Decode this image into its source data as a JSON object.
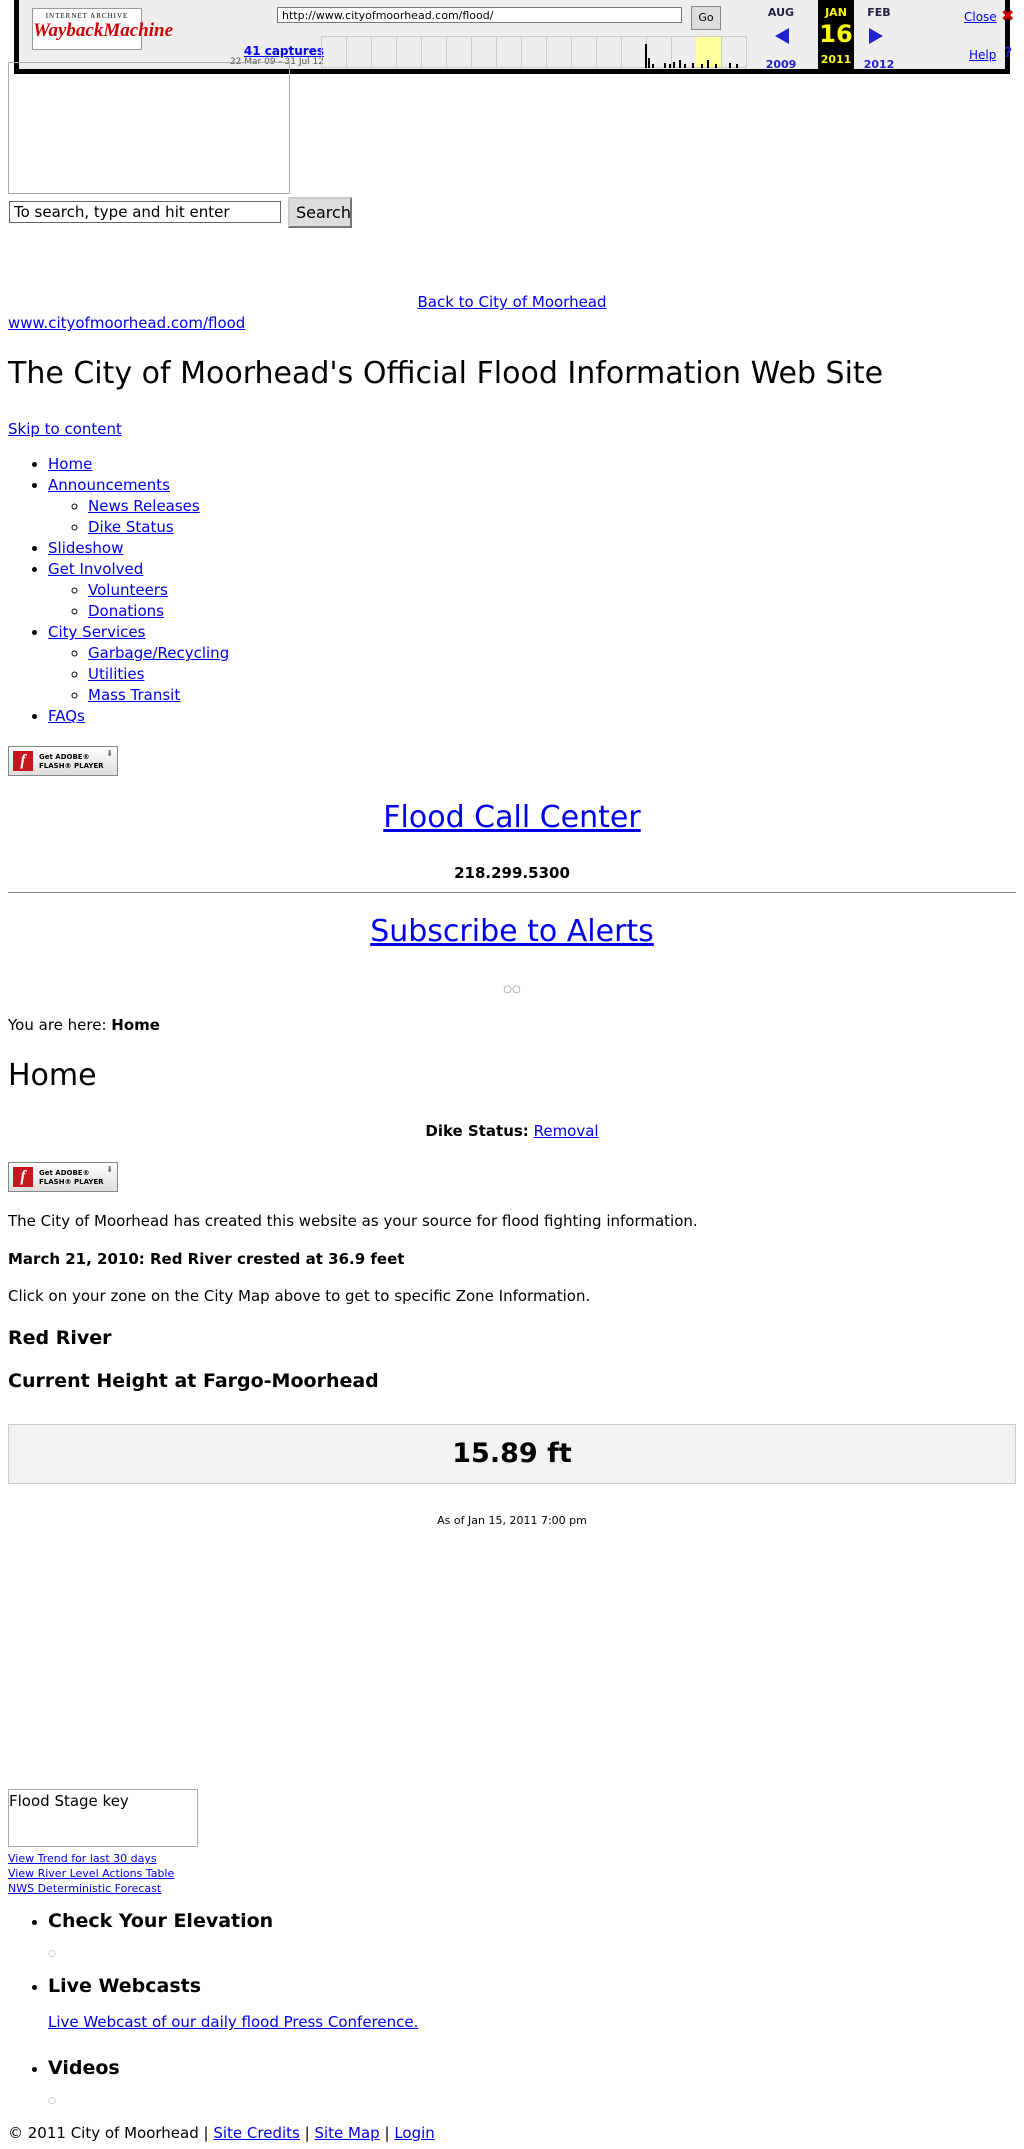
{
  "wayback": {
    "logo_top": "INTERNET ARCHIVE",
    "logo_main": "WaybackMachine",
    "url": "http://www.cityofmoorhead.com/flood/",
    "go_label": "Go",
    "captures_label": "41 captures",
    "range_label": "22 Mar 09 - 31 Jul 12",
    "prev_month": "AUG",
    "cur_month": "JAN",
    "next_month": "FEB",
    "prev_year": "2009",
    "cur_day": "16",
    "cur_year": "2011",
    "next_year": "2012",
    "close_label": "Close",
    "help_label": "Help",
    "close_glyph": "✖",
    "help_glyph": "?"
  },
  "search": {
    "value": "To search, type and hit enter",
    "button_label": "Search"
  },
  "header": {
    "back_link": "Back to City of Moorhead",
    "site_url": "www.cityofmoorhead.com/flood",
    "site_title": "The City of Moorhead's Official Flood Information Web Site",
    "skip_link": "Skip to content"
  },
  "nav": [
    {
      "label": "Home",
      "children": []
    },
    {
      "label": "Announcements",
      "children": [
        "News Releases",
        "Dike Status"
      ]
    },
    {
      "label": "Slideshow",
      "children": []
    },
    {
      "label": "Get Involved",
      "children": [
        "Volunteers",
        "Donations"
      ]
    },
    {
      "label": "City Services",
      "children": [
        "Garbage/Recycling",
        "Utilities",
        "Mass Transit"
      ]
    },
    {
      "label": "FAQs",
      "children": []
    }
  ],
  "flash_badge": {
    "line1": "Get ADOBE®",
    "line2": "FLASH® PLAYER",
    "logo_letter": "f"
  },
  "promo": {
    "call_center": "Flood Call Center",
    "phone": "218.299.5300",
    "subscribe": "Subscribe to Alerts",
    "dots": "○○"
  },
  "breadcrumb": {
    "prefix": "You are here:",
    "current": "Home"
  },
  "main": {
    "heading": "Home",
    "dike_label": "Dike Status:",
    "dike_value": "Removal",
    "intro": "The City of Moorhead has created this website as your source for flood fighting information.",
    "crest": "March 21, 2010: Red River crested at 36.9 feet",
    "zone": "Click on your zone on the City Map above to get to specific Zone Information.",
    "river_heading": "Red River",
    "current_heading": "Current Height at Fargo-Moorhead",
    "height": "15.89 ft",
    "as_of": "As of Jan 15, 2011 7:00 pm",
    "stage_key": "Flood Stage key",
    "links": [
      "View Trend for last 30 days",
      "View River Level Actions Table",
      "NWS Deterministic Forecast"
    ]
  },
  "sidebar": {
    "elevation_heading": "Check Your Elevation",
    "webcams_heading": "Live Webcasts",
    "webcast_link": "Live Webcast of our daily flood Press Conference.",
    "videos_heading": "Videos"
  },
  "footer": {
    "copyright": "© 2011 City of Moorhead |",
    "site_credits": "Site Credits",
    "sep": "|",
    "site_map": "Site Map",
    "login": "Login"
  },
  "colors": {
    "link": "#0000ee",
    "wayback_highlight": "#ffff00",
    "flash_red": "#c8161d"
  }
}
